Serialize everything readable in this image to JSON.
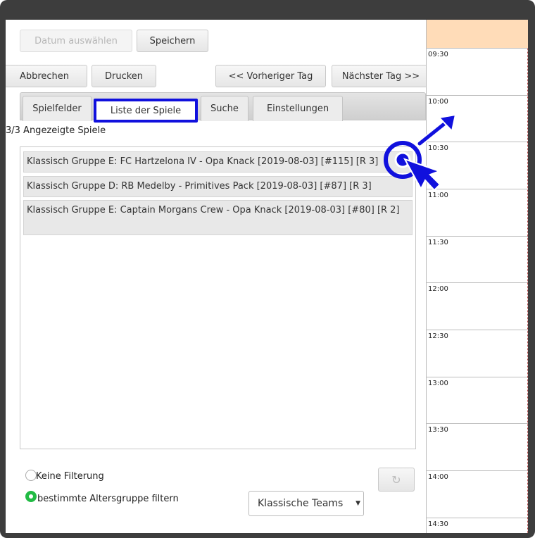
{
  "toolbar": {
    "date_label": "Datum auswählen",
    "save_label": "Speichern",
    "cancel_label": "Abbrechen",
    "print_label": "Drucken",
    "prev_day_label": "<< Vorheriger Tag",
    "next_day_label": "Nächster Tag >>"
  },
  "tabs": {
    "fields": "Spielfelder",
    "games_list": "Liste der Spiele",
    "search": "Suche",
    "settings": "Einstellungen"
  },
  "games_count": "3/3 Angezeigte Spiele",
  "games": [
    "Klassisch Gruppe E: FC Hartzelona IV - Opa Knack [2019-08-03] [#115] [R 3]",
    "Klassisch Gruppe D: RB Medelby - Primitives Pack [2019-08-03] [#87] [R 3]",
    "Klassisch Gruppe E: Captain Morgans Crew - Opa Knack [2019-08-03] [#80] [R 2]"
  ],
  "filter": {
    "none_label": "Keine Filterung",
    "age_group_label": "bestimmte Altersgruppe filtern",
    "selected": "age_group",
    "team_select_value": "Klassische Teams"
  },
  "calendar": {
    "times": [
      "09:30",
      "10:00",
      "10:30",
      "11:00",
      "11:30",
      "12:00",
      "12:30",
      "13:00",
      "13:30",
      "14:00",
      "14:30"
    ]
  },
  "colors": {
    "highlight": "#1010dd",
    "calendar_header": "#ffdcb8",
    "radio_selected": "#22bb44"
  }
}
